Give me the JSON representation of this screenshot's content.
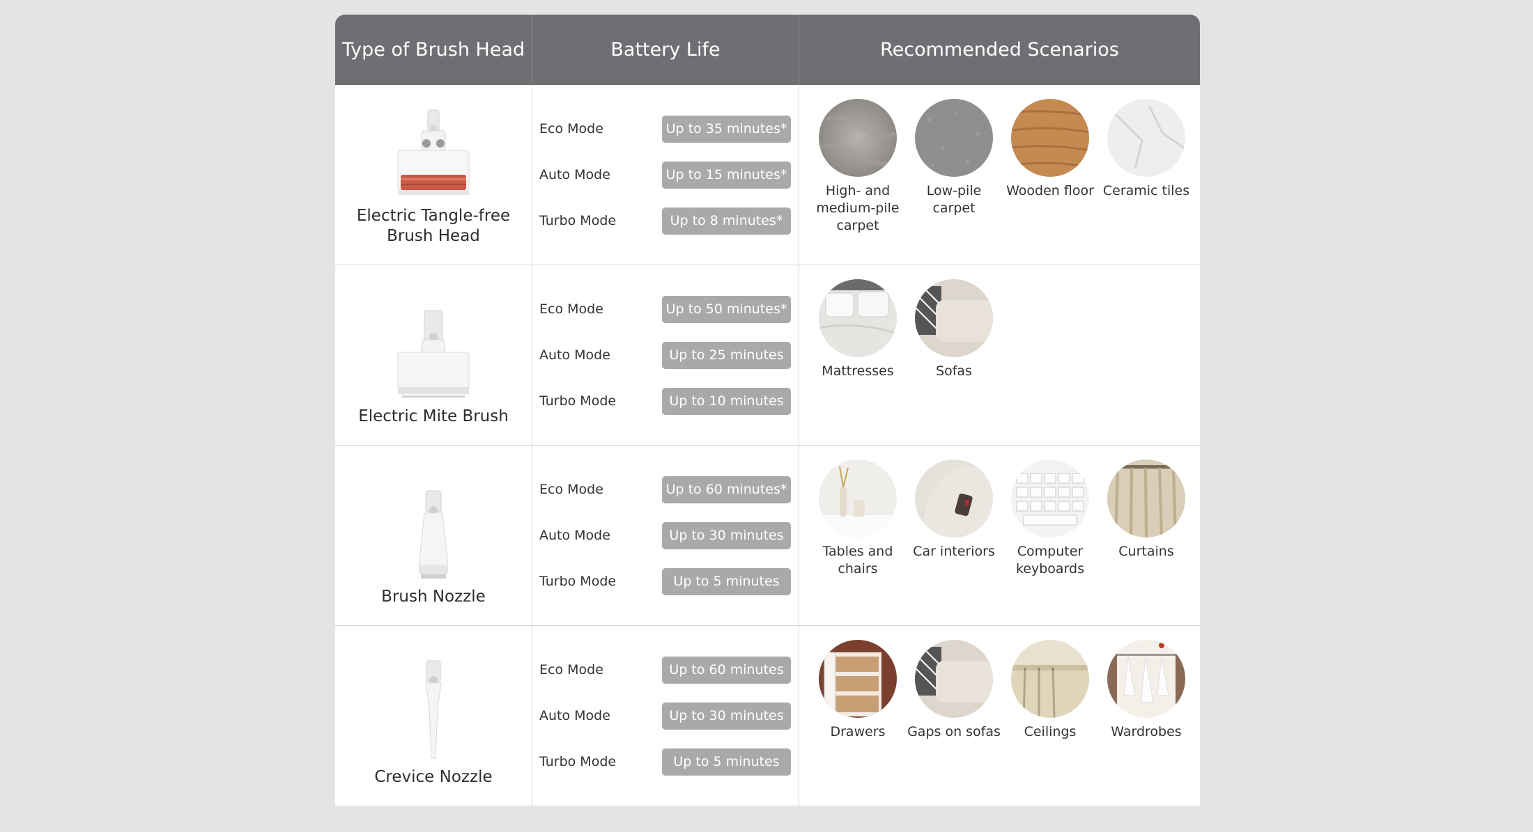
{
  "header": {
    "brush_head": "Type of Brush Head",
    "battery_life": "Battery Life",
    "scenarios": "Recommended Scenarios"
  },
  "rows": [
    {
      "name": "Electric Tangle-free Brush Head",
      "icon": "tangle-free-brush-head-icon",
      "modes": [
        {
          "label": "Eco Mode",
          "value": "Up to 35 minutes*"
        },
        {
          "label": "Auto Mode",
          "value": "Up to 15 minutes*"
        },
        {
          "label": "Turbo Mode",
          "value": "Up to 8 minutes*"
        }
      ],
      "scenarios": [
        {
          "label": "High- and medium-pile carpet",
          "image": "shaggy-carpet"
        },
        {
          "label": "Low-pile carpet",
          "image": "low-carpet"
        },
        {
          "label": "Wooden floor",
          "image": "wood"
        },
        {
          "label": "Ceramic tiles",
          "image": "marble"
        }
      ]
    },
    {
      "name": "Electric Mite Brush",
      "icon": "mite-brush-icon",
      "modes": [
        {
          "label": "Eco Mode",
          "value": "Up to 50 minutes*"
        },
        {
          "label": "Auto Mode",
          "value": "Up to 25 minutes"
        },
        {
          "label": "Turbo Mode",
          "value": "Up to 10 minutes"
        }
      ],
      "scenarios": [
        {
          "label": "Mattresses",
          "image": "bed"
        },
        {
          "label": "Sofas",
          "image": "sofa"
        }
      ]
    },
    {
      "name": "Brush Nozzle",
      "icon": "brush-nozzle-icon",
      "modes": [
        {
          "label": "Eco Mode",
          "value": "Up to 60 minutes*"
        },
        {
          "label": "Auto Mode",
          "value": "Up to 30 minutes"
        },
        {
          "label": "Turbo Mode",
          "value": "Up to 5 minutes"
        }
      ],
      "scenarios": [
        {
          "label": "Tables and chairs",
          "image": "table"
        },
        {
          "label": "Car interiors",
          "image": "car-seat"
        },
        {
          "label": "Computer keyboards",
          "image": "keyboard"
        },
        {
          "label": "Curtains",
          "image": "curtain"
        }
      ]
    },
    {
      "name": "Crevice Nozzle",
      "icon": "crevice-nozzle-icon",
      "modes": [
        {
          "label": "Eco Mode",
          "value": "Up to 60 minutes"
        },
        {
          "label": "Auto Mode",
          "value": "Up to 30 minutes"
        },
        {
          "label": "Turbo Mode",
          "value": "Up to 5 minutes"
        }
      ],
      "scenarios": [
        {
          "label": "Drawers",
          "image": "drawers"
        },
        {
          "label": "Gaps on sofas",
          "image": "sofa"
        },
        {
          "label": "Ceilings",
          "image": "ceiling"
        },
        {
          "label": "Wardrobes",
          "image": "wardrobe"
        }
      ]
    }
  ],
  "colors": {
    "header_bg": "#6f6f73",
    "pill_bg": "#a9a9a9",
    "page_bg": "#e4e4e4"
  }
}
